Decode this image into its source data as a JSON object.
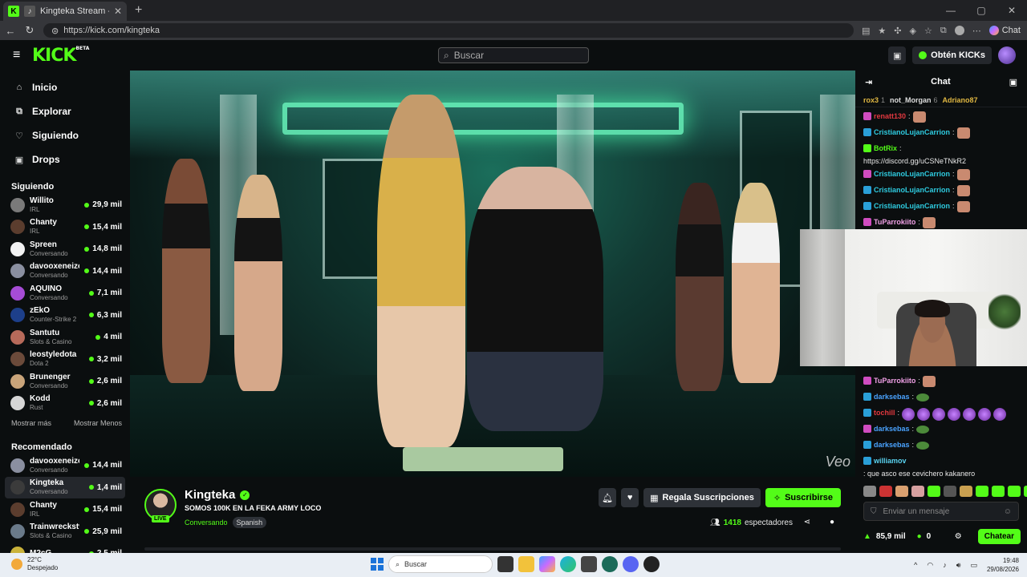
{
  "browser": {
    "tab_title": "Kingteka Stream - Watch Live",
    "url": "https://kick.com/kingteka",
    "chat_label": "Chat"
  },
  "header": {
    "logo": "KICK",
    "logo_tag": "BETA",
    "search_placeholder": "Buscar",
    "kicks_label": "Obtén KICKs"
  },
  "nav": [
    {
      "label": "Inicio",
      "icon": "home-icon"
    },
    {
      "label": "Explorar",
      "icon": "explore-icon"
    },
    {
      "label": "Siguiendo",
      "icon": "heart-icon"
    },
    {
      "label": "Drops",
      "icon": "gift-icon"
    }
  ],
  "following": {
    "title": "Siguiendo",
    "channels": [
      {
        "name": "Willito",
        "category": "IRL",
        "viewers": "29,9 mil",
        "color": "#7a7a7a"
      },
      {
        "name": "Chanty",
        "category": "IRL",
        "viewers": "15,4 mil",
        "color": "#5b3d2e"
      },
      {
        "name": "Spreen",
        "category": "Conversando",
        "viewers": "14,8 mil",
        "color": "#f2f2f2"
      },
      {
        "name": "davooxeneize",
        "category": "Conversando",
        "viewers": "14,4 mil",
        "color": "#8a8fa0"
      },
      {
        "name": "AQUINO",
        "category": "Conversando",
        "viewers": "7,1 mil",
        "color": "#a64cd6"
      },
      {
        "name": "zEkO",
        "category": "Counter-Strike 2",
        "viewers": "6,3 mil",
        "color": "#1d3f8a"
      },
      {
        "name": "Santutu",
        "category": "Slots & Casino",
        "viewers": "4 mil",
        "color": "#b76a5a"
      },
      {
        "name": "leostyledota",
        "category": "Dota 2",
        "viewers": "3,2 mil",
        "color": "#6b4a3a"
      },
      {
        "name": "Brunenger",
        "category": "Conversando",
        "viewers": "2,6 mil",
        "color": "#c9a47a"
      },
      {
        "name": "Kodd",
        "category": "Rust",
        "viewers": "2,6 mil",
        "color": "#d6d6d6"
      }
    ],
    "show_more": "Mostrar más",
    "show_less": "Mostrar Menos"
  },
  "recommended": {
    "title": "Recomendado",
    "channels": [
      {
        "name": "davooxeneize",
        "category": "Conversando",
        "viewers": "14,4 mil",
        "color": "#8a8fa0"
      },
      {
        "name": "Kingteka",
        "category": "Conversando",
        "viewers": "1,4 mil",
        "color": "#3b3b3b",
        "active": true
      },
      {
        "name": "Chanty",
        "category": "IRL",
        "viewers": "15,4 mil",
        "color": "#5b3d2e"
      },
      {
        "name": "Trainwreckstv",
        "category": "Slots & Casino",
        "viewers": "25,9 mil",
        "color": "#6a7a8a"
      },
      {
        "name": "M2cG",
        "category": "",
        "viewers": "2,5 mil",
        "color": "#c9b23a"
      }
    ]
  },
  "video": {
    "watermark": "Veo"
  },
  "stream": {
    "name": "Kingteka",
    "live": "LIVE",
    "title": "SOMOS 100K EN LA FEKA ARMY LOCO",
    "category": "Conversando",
    "language": "Spanish",
    "gift_label": "Regala Suscripciones",
    "subscribe_label": "Suscribirse",
    "viewers_count": "1418",
    "viewers_label": "espectadores"
  },
  "chat": {
    "title": "Chat",
    "leaders": [
      {
        "name": "rox3",
        "count": "1"
      },
      {
        "name": "not_Morgan",
        "count": "6"
      },
      {
        "name": "Adriano87",
        "count": ""
      }
    ],
    "messages": [
      {
        "user": "renatt130",
        "color": "#e2383f",
        "text": ":",
        "emotes": 1
      },
      {
        "user": "CristianoLujanCarrion",
        "color": "#2ecbe0",
        "text": ":",
        "emotes": 1
      },
      {
        "user": "BotRix",
        "color": "#53fc18",
        "text": ":",
        "link": "https://discord.gg/uCSNeTNkR2"
      },
      {
        "user": "CristianoLujanCarrion",
        "color": "#2ecbe0",
        "text": ":",
        "emotes": 1
      },
      {
        "user": "CristianoLujanCarrion",
        "color": "#2ecbe0",
        "text": ":",
        "emotes": 1
      },
      {
        "user": "CristianoLujanCarrion",
        "color": "#2ecbe0",
        "text": ":",
        "emotes": 1
      },
      {
        "user": "TuParrokiito",
        "color": "#f0a0e6",
        "text": ":",
        "emotes": 1
      }
    ],
    "messages_lower": [
      {
        "user": "TuParrokiito",
        "color": "#f0a0e6",
        "text": ":",
        "emotes": 1
      },
      {
        "user": "darksebas",
        "color": "#4aa3ff",
        "text": ":",
        "frog": 1
      },
      {
        "user": "tochill",
        "color": "#e2383f",
        "text": ":",
        "purple": 7
      },
      {
        "user": "darksebas",
        "color": "#4aa3ff",
        "text": ":",
        "frog": 1
      },
      {
        "user": "darksebas",
        "color": "#4aa3ff",
        "text": ":",
        "frog": 1
      },
      {
        "user": "williamov",
        "color": "#5ad3f0",
        "text": ": que asco ese cevichero kakanero"
      }
    ],
    "input_placeholder": "Enviar un mensaje",
    "points": "85,9 mil",
    "kicks": "0",
    "send_label": "Chatear"
  },
  "taskbar": {
    "temp": "22°C",
    "weather": "Despejado",
    "search_placeholder": "Buscar",
    "time": "19:48",
    "date": "29/08/2026"
  }
}
